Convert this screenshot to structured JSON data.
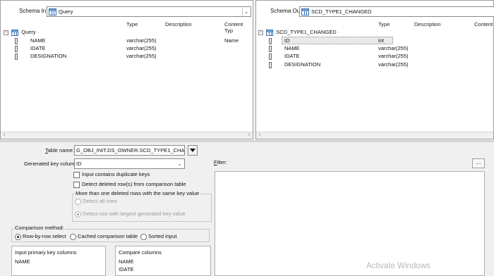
{
  "schema_in": {
    "label": "Schema In:",
    "selected": "Query",
    "columns": [
      "Type",
      "Description",
      "Content Typ"
    ],
    "root": "Query",
    "rows": [
      {
        "name": "NAME",
        "type": "varchar(255)",
        "content": "Name"
      },
      {
        "name": "IDATE",
        "type": "varchar(255)",
        "content": ""
      },
      {
        "name": "DESIGNATION",
        "type": "varchar(255)",
        "content": ""
      }
    ]
  },
  "schema_out": {
    "label": "Schema Out:",
    "selected": "SCD_TYPE1_CHANGED",
    "columns": [
      "Type",
      "Description",
      "Content"
    ],
    "root": "SCD_TYPE1_CHANGED",
    "rows": [
      {
        "name": "ID",
        "type": "int"
      },
      {
        "name": "NAME",
        "type": "varchar(255)"
      },
      {
        "name": "IDATE",
        "type": "varchar(255)"
      },
      {
        "name": "DESIGNATION",
        "type": "varchar(255)"
      }
    ]
  },
  "options": {
    "table_name_label": "Table name:",
    "table_name_value": "G_OBJ_INIT.DS_OWNER.SCD_TYPE1_CHANGED",
    "gen_key_label": "Generated key column:",
    "gen_key_value": "ID",
    "input_dup_label": "Input contains duplicate keys",
    "detect_deleted_label": "Detect deleted row(s) from comparison table",
    "multi_deleted_label": "More than one deleted rows with the same key value",
    "detect_all_label": "Detect all rows",
    "detect_largest_label": "Detect row with largest generated key value",
    "comparison_method_label": "Comparison method:",
    "methods": [
      "Row-by-row select",
      "Cached comparison table",
      "Sorted input"
    ],
    "input_pk_label": "Input primary key columns",
    "input_pk_values": [
      "NAME"
    ],
    "compare_cols_label": "Compare columns",
    "compare_cols_values": [
      "NAME",
      "IDATE"
    ],
    "filter_label": "Filter:",
    "filter_button": "..."
  },
  "watermark": "Activate Windows"
}
